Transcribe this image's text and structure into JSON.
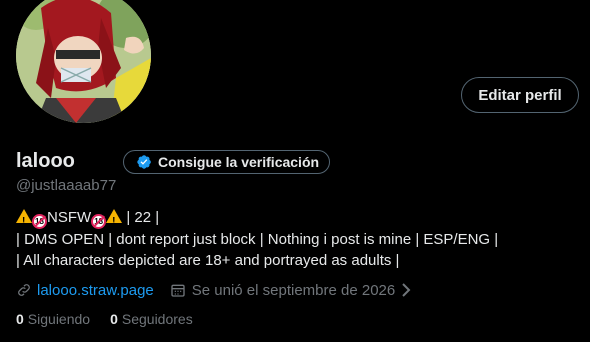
{
  "profile": {
    "name": "lalooo",
    "handle": "@justlaaaab77",
    "edit_label": "Editar perfil",
    "verify_label": "Consigue la verificación",
    "bio": {
      "line1_text": "NSFW",
      "line1_tail": " | 22 |",
      "line2": " | DMS OPEN | dont report just block | Nothing i post is mine | ESP/ENG |",
      "line3": " | All characters depicted are 18+ and portrayed as adults |"
    },
    "link": "lalooo.straw.page",
    "joined": "Se unió el septiembre de 2026",
    "following_count": "0",
    "following_label": "Siguiendo",
    "followers_count": "0",
    "followers_label": "Seguidores"
  },
  "colors": {
    "background": "#000000",
    "text": "#e7e9ea",
    "muted": "#71767b",
    "accent": "#1d9bf0",
    "border": "#536471"
  },
  "icons": {
    "verify": "verified-badge-icon",
    "link": "link-icon",
    "calendar": "calendar-icon",
    "chevron": "chevron-right-icon",
    "warning": "warning-icon",
    "no18": "no-under-18-icon"
  }
}
